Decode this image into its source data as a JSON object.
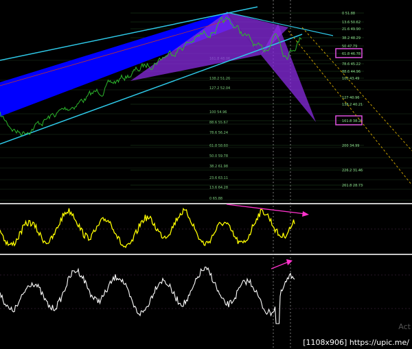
{
  "chart_data": [
    {
      "type": "line",
      "panel": "price",
      "title": "",
      "xlabel": "",
      "ylabel": "",
      "grid": true,
      "fib_levels_right": [
        {
          "label": "0 51.88"
        },
        {
          "label": "13.6 50.62"
        },
        {
          "label": "21.6 49.90"
        },
        {
          "label": "38.2 48.29"
        },
        {
          "label": "50 47.79"
        },
        {
          "label": "61.8 46.78",
          "boxed": true
        },
        {
          "label": "78.6 45.22"
        },
        {
          "label": "88.6 44.96"
        },
        {
          "label": "100 43.49"
        },
        {
          "label": "127 40.96"
        },
        {
          "label": "138.2 40.21"
        },
        {
          "label": "161.8 38.25",
          "boxed": true
        },
        {
          "label": "200 34.99"
        },
        {
          "label": "226.2 31.46"
        },
        {
          "label": "261.8 28.73"
        }
      ],
      "fib_levels_center": [
        {
          "label": "161.8 48.06"
        },
        {
          "label": "138.2 51.26"
        },
        {
          "label": "127.2 52.04"
        },
        {
          "label": "100 54.96"
        },
        {
          "label": "88.6 55.67"
        },
        {
          "label": "78.6 56.24"
        },
        {
          "label": "61.8 58.60"
        },
        {
          "label": "50.0 59.78"
        },
        {
          "label": "38.2 61.98"
        },
        {
          "label": "23.6 63.11"
        },
        {
          "label": "13.6 64.28"
        },
        {
          "label": "0 65.88"
        }
      ],
      "colors": {
        "price": "#2db82d",
        "channel": "#2ec9e8",
        "channel_fill": "#0000ff",
        "pattern": "#8a2be2",
        "projection": "#c8a000"
      }
    },
    {
      "type": "line",
      "panel": "oscillator-1",
      "title": "",
      "divergence_arrow": true,
      "colors": {
        "line": "#ffff00",
        "arrow": "#ff33cc"
      }
    },
    {
      "type": "line",
      "panel": "oscillator-2",
      "title": "",
      "divergence_arrow": true,
      "colors": {
        "line": "#ffffff",
        "arrow": "#ff33cc"
      }
    }
  ],
  "footer": {
    "text": "[1108x906] https://upic.me/"
  },
  "watermark": {
    "text": "Act"
  }
}
